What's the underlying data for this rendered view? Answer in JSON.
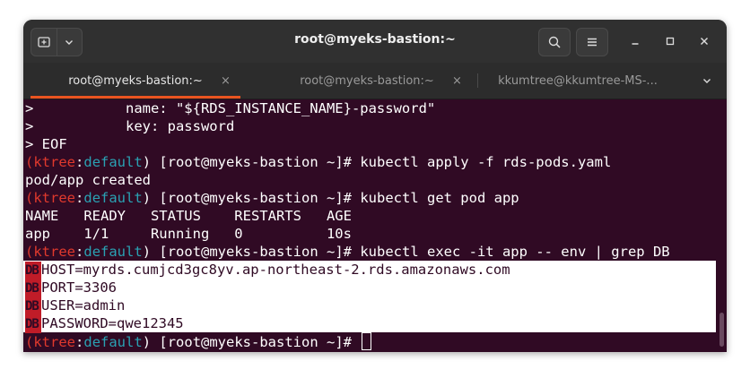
{
  "window": {
    "title": "root@myeks-bastion:~"
  },
  "header": {
    "icons": {
      "new_tab": "new-tab-icon",
      "menu_dropdown": "chevron-down-icon",
      "search": "search-icon",
      "hamburger": "hamburger-menu-icon",
      "minimize": "minimize-icon",
      "maximize": "maximize-icon",
      "close": "close-icon"
    }
  },
  "tabs": [
    {
      "label": "root@myeks-bastion:~",
      "active": true,
      "close": "×"
    },
    {
      "label": "root@myeks-bastion:~",
      "active": false,
      "close": "×"
    },
    {
      "label": "kkumtree@kkumtree-MS-...",
      "active": false
    }
  ],
  "colors": {
    "terminal_bg": "#300a24",
    "accent": "#e95420",
    "prompt_paren": "#e0392d",
    "prompt_namespace": "#2aa1b3"
  },
  "terminal": {
    "lines": [
      {
        "text": ">           name: \"${RDS_INSTANCE_NAME}-password\""
      },
      {
        "text": ">           key: password"
      },
      {
        "text": "> EOF"
      },
      {
        "prompt": {
          "open": "(",
          "ctx": "ktree",
          "sep": ":",
          "ns": "default",
          "close": ")",
          "rest": " [root@myeks-bastion ~]# "
        },
        "cmd": "kubectl apply -f rds-pods.yaml"
      },
      {
        "text": "pod/app created"
      },
      {
        "prompt": {
          "open": "(",
          "ctx": "ktree",
          "sep": ":",
          "ns": "default",
          "close": ")",
          "rest": " [root@myeks-bastion ~]# "
        },
        "cmd": "kubectl get pod app"
      },
      {
        "text": "NAME   READY   STATUS    RESTARTS   AGE"
      },
      {
        "text": "app    1/1     Running   0          10s"
      },
      {
        "prompt": {
          "open": "(",
          "ctx": "ktree",
          "sep": ":",
          "ns": "default",
          "close": ")",
          "rest": " [root@myeks-bastion ~]# "
        },
        "cmd": "kubectl exec -it app -- env | grep DB"
      }
    ],
    "grep_match": "DB",
    "env_lines": [
      "HOST=myrds.cumjcd3gc8yv.ap-northeast-2.rds.amazonaws.com",
      "PORT=3306",
      "USER=admin",
      "PASSWORD=qwe12345"
    ],
    "final_prompt": {
      "open": "(",
      "ctx": "ktree",
      "sep": ":",
      "ns": "default",
      "close": ")",
      "rest": " [root@myeks-bastion ~]# "
    }
  }
}
